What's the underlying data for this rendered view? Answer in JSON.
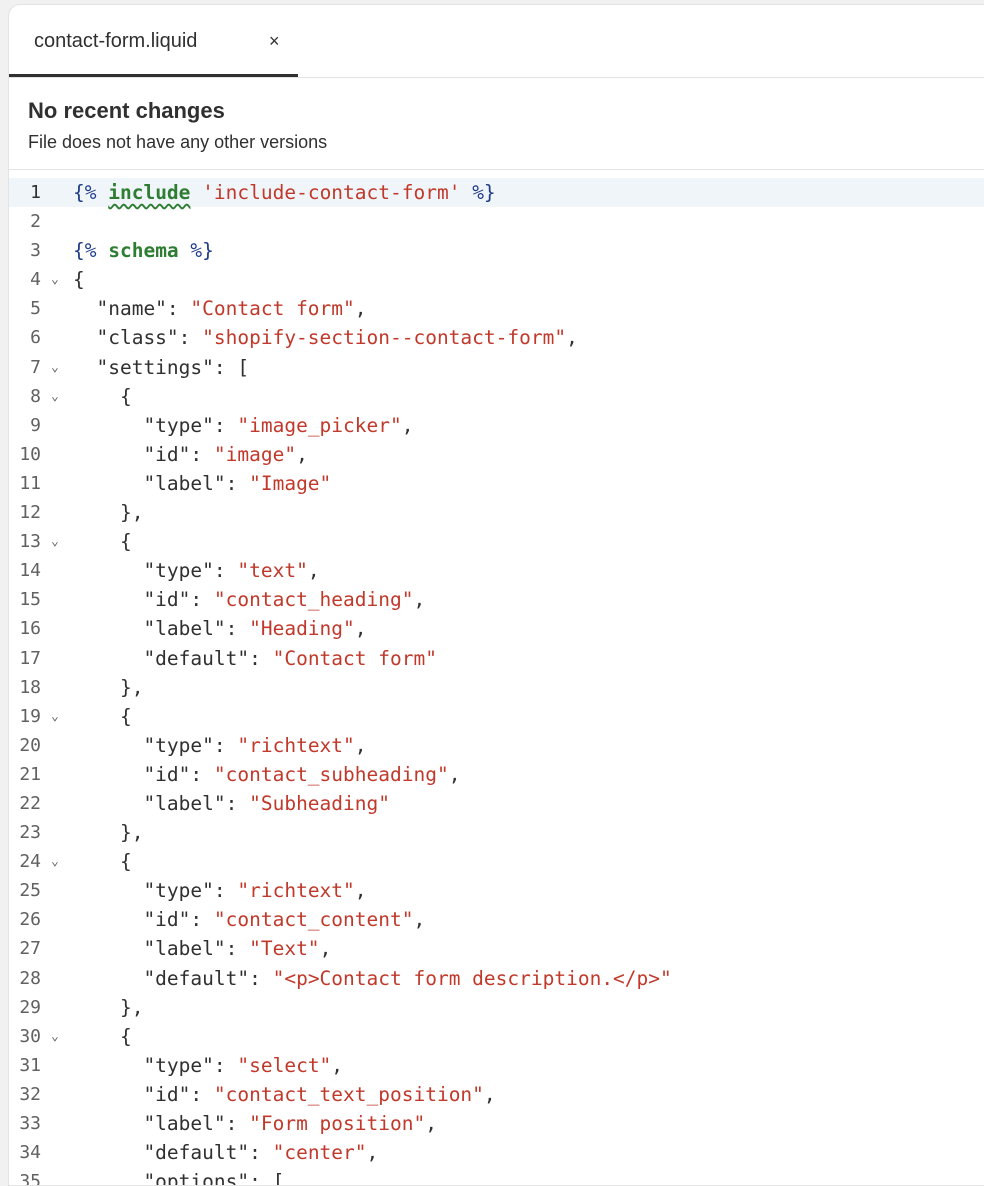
{
  "tab": {
    "filename": "contact-form.liquid",
    "close_glyph": "×"
  },
  "notice": {
    "title": "No recent changes",
    "subtitle": "File does not have any other versions"
  },
  "editor": {
    "lines": [
      {
        "n": "1",
        "fold": false,
        "segments": [
          [
            "d",
            "{% "
          ],
          [
            "k",
            "include"
          ],
          [
            "p",
            " "
          ],
          [
            "s",
            "'include-contact-form'"
          ],
          [
            "d",
            " %}"
          ]
        ]
      },
      {
        "n": "2",
        "fold": false,
        "segments": []
      },
      {
        "n": "3",
        "fold": false,
        "segments": [
          [
            "d",
            "{% "
          ],
          [
            "k",
            "schema"
          ],
          [
            "d",
            " %}"
          ]
        ]
      },
      {
        "n": "4",
        "fold": true,
        "segments": [
          [
            "p",
            "{"
          ]
        ]
      },
      {
        "n": "5",
        "fold": false,
        "segments": [
          [
            "p",
            "  \"name\": "
          ],
          [
            "s",
            "\"Contact form\""
          ],
          [
            "p",
            ","
          ]
        ]
      },
      {
        "n": "6",
        "fold": false,
        "segments": [
          [
            "p",
            "  \"class\": "
          ],
          [
            "s",
            "\"shopify-section--contact-form\""
          ],
          [
            "p",
            ","
          ]
        ]
      },
      {
        "n": "7",
        "fold": true,
        "segments": [
          [
            "p",
            "  \"settings\": ["
          ]
        ]
      },
      {
        "n": "8",
        "fold": true,
        "segments": [
          [
            "p",
            "    {"
          ]
        ]
      },
      {
        "n": "9",
        "fold": false,
        "segments": [
          [
            "p",
            "      \"type\": "
          ],
          [
            "s",
            "\"image_picker\""
          ],
          [
            "p",
            ","
          ]
        ]
      },
      {
        "n": "10",
        "fold": false,
        "segments": [
          [
            "p",
            "      \"id\": "
          ],
          [
            "s",
            "\"image\""
          ],
          [
            "p",
            ","
          ]
        ]
      },
      {
        "n": "11",
        "fold": false,
        "segments": [
          [
            "p",
            "      \"label\": "
          ],
          [
            "s",
            "\"Image\""
          ]
        ]
      },
      {
        "n": "12",
        "fold": false,
        "segments": [
          [
            "p",
            "    },"
          ]
        ]
      },
      {
        "n": "13",
        "fold": true,
        "segments": [
          [
            "p",
            "    {"
          ]
        ]
      },
      {
        "n": "14",
        "fold": false,
        "segments": [
          [
            "p",
            "      \"type\": "
          ],
          [
            "s",
            "\"text\""
          ],
          [
            "p",
            ","
          ]
        ]
      },
      {
        "n": "15",
        "fold": false,
        "segments": [
          [
            "p",
            "      \"id\": "
          ],
          [
            "s",
            "\"contact_heading\""
          ],
          [
            "p",
            ","
          ]
        ]
      },
      {
        "n": "16",
        "fold": false,
        "segments": [
          [
            "p",
            "      \"label\": "
          ],
          [
            "s",
            "\"Heading\""
          ],
          [
            "p",
            ","
          ]
        ]
      },
      {
        "n": "17",
        "fold": false,
        "segments": [
          [
            "p",
            "      \"default\": "
          ],
          [
            "s",
            "\"Contact form\""
          ]
        ]
      },
      {
        "n": "18",
        "fold": false,
        "segments": [
          [
            "p",
            "    },"
          ]
        ]
      },
      {
        "n": "19",
        "fold": true,
        "segments": [
          [
            "p",
            "    {"
          ]
        ]
      },
      {
        "n": "20",
        "fold": false,
        "segments": [
          [
            "p",
            "      \"type\": "
          ],
          [
            "s",
            "\"richtext\""
          ],
          [
            "p",
            ","
          ]
        ]
      },
      {
        "n": "21",
        "fold": false,
        "segments": [
          [
            "p",
            "      \"id\": "
          ],
          [
            "s",
            "\"contact_subheading\""
          ],
          [
            "p",
            ","
          ]
        ]
      },
      {
        "n": "22",
        "fold": false,
        "segments": [
          [
            "p",
            "      \"label\": "
          ],
          [
            "s",
            "\"Subheading\""
          ]
        ]
      },
      {
        "n": "23",
        "fold": false,
        "segments": [
          [
            "p",
            "    },"
          ]
        ]
      },
      {
        "n": "24",
        "fold": true,
        "segments": [
          [
            "p",
            "    {"
          ]
        ]
      },
      {
        "n": "25",
        "fold": false,
        "segments": [
          [
            "p",
            "      \"type\": "
          ],
          [
            "s",
            "\"richtext\""
          ],
          [
            "p",
            ","
          ]
        ]
      },
      {
        "n": "26",
        "fold": false,
        "segments": [
          [
            "p",
            "      \"id\": "
          ],
          [
            "s",
            "\"contact_content\""
          ],
          [
            "p",
            ","
          ]
        ]
      },
      {
        "n": "27",
        "fold": false,
        "segments": [
          [
            "p",
            "      \"label\": "
          ],
          [
            "s",
            "\"Text\""
          ],
          [
            "p",
            ","
          ]
        ]
      },
      {
        "n": "28",
        "fold": false,
        "segments": [
          [
            "p",
            "      \"default\": "
          ],
          [
            "s",
            "\"<p>Contact form description.</p>\""
          ]
        ]
      },
      {
        "n": "29",
        "fold": false,
        "segments": [
          [
            "p",
            "    },"
          ]
        ]
      },
      {
        "n": "30",
        "fold": true,
        "segments": [
          [
            "p",
            "    {"
          ]
        ]
      },
      {
        "n": "31",
        "fold": false,
        "segments": [
          [
            "p",
            "      \"type\": "
          ],
          [
            "s",
            "\"select\""
          ],
          [
            "p",
            ","
          ]
        ]
      },
      {
        "n": "32",
        "fold": false,
        "segments": [
          [
            "p",
            "      \"id\": "
          ],
          [
            "s",
            "\"contact_text_position\""
          ],
          [
            "p",
            ","
          ]
        ]
      },
      {
        "n": "33",
        "fold": false,
        "segments": [
          [
            "p",
            "      \"label\": "
          ],
          [
            "s",
            "\"Form position\""
          ],
          [
            "p",
            ","
          ]
        ]
      },
      {
        "n": "34",
        "fold": false,
        "segments": [
          [
            "p",
            "      \"default\": "
          ],
          [
            "s",
            "\"center\""
          ],
          [
            "p",
            ","
          ]
        ]
      },
      {
        "n": "35",
        "fold": false,
        "segments": [
          [
            "p",
            "      \"options\": ["
          ]
        ]
      }
    ]
  }
}
